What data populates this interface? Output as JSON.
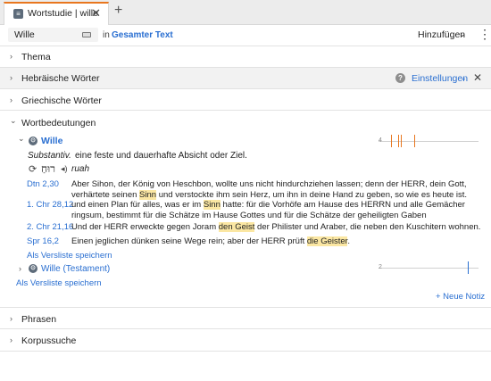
{
  "tab": {
    "title": "Wortstudie | wille",
    "close": "✕",
    "add": "+"
  },
  "search": {
    "value": "Wille",
    "in_label": "in",
    "scope": "Gesamter Text",
    "add_label": "Hinzufügen",
    "add_chevron": "⌄",
    "more": "⋮"
  },
  "sections": {
    "thema": "Thema",
    "hebrew": "Hebräische Wörter",
    "greek": "Griechische Wörter",
    "meanings": "Wortbedeutungen",
    "phrases": "Phrasen",
    "corpus": "Korpussuche"
  },
  "hebrew_tools": {
    "help": "?",
    "settings": "Einstellungen",
    "settings_chevron": "⌄",
    "close": "✕"
  },
  "sense1": {
    "label": "Wille",
    "definition_pos": "Substantiv.",
    "definition_text": " eine feste und dauerhafte Absicht oder Ziel.",
    "hebrew": "רוּחַ",
    "translit": "ruah",
    "spark_count": "4",
    "verses": [
      {
        "ref": "Dtn 2,30",
        "parts": [
          "Aber Sihon, der König von Heschbon, wollte uns nicht hindurchziehen lassen; denn der ",
          "HERR",
          ", dein Gott, verhärtete seinen ",
          "Sinn",
          " und verstockte ihm sein Herz, um ihn in deine Hand zu geben, so wie es heute ist."
        ]
      },
      {
        "ref": "1. Chr 28,12",
        "parts": [
          "und einen Plan für alles, was er im ",
          "Sinn",
          " hatte: für die Vorhöfe am Hause des ",
          "HERRN",
          " und alle Gemächer ringsum, bestimmt für die Schätze im Hause Gottes und für die Schätze der geheiligten Gaben"
        ]
      },
      {
        "ref": "2. Chr 21,16",
        "parts": [
          "Und der ",
          "HERR",
          " erweckte gegen Joram ",
          "den Geist",
          " der Philister und Araber, die neben den Kuschitern wohnen."
        ]
      },
      {
        "ref": "Spr 16,2",
        "parts": [
          "Einen jeglichen dünken seine Wege rein; aber der ",
          "HERR",
          " prüft ",
          "die Geister",
          "."
        ]
      }
    ],
    "save_link": "Als Versliste speichern"
  },
  "sense2": {
    "label": "Wille (Testament)",
    "spark_count": "2"
  },
  "save_link_outer": "Als Versliste speichern",
  "new_note": "+ Neue Notiz",
  "colors": {
    "accent": "#e8761e",
    "link": "#2a6fd1",
    "highlight": "#fbe7a3"
  },
  "icons": {
    "chevron_right": "›",
    "chevron_down": "⌄",
    "refresh": "⟳",
    "sound": "🔊"
  }
}
